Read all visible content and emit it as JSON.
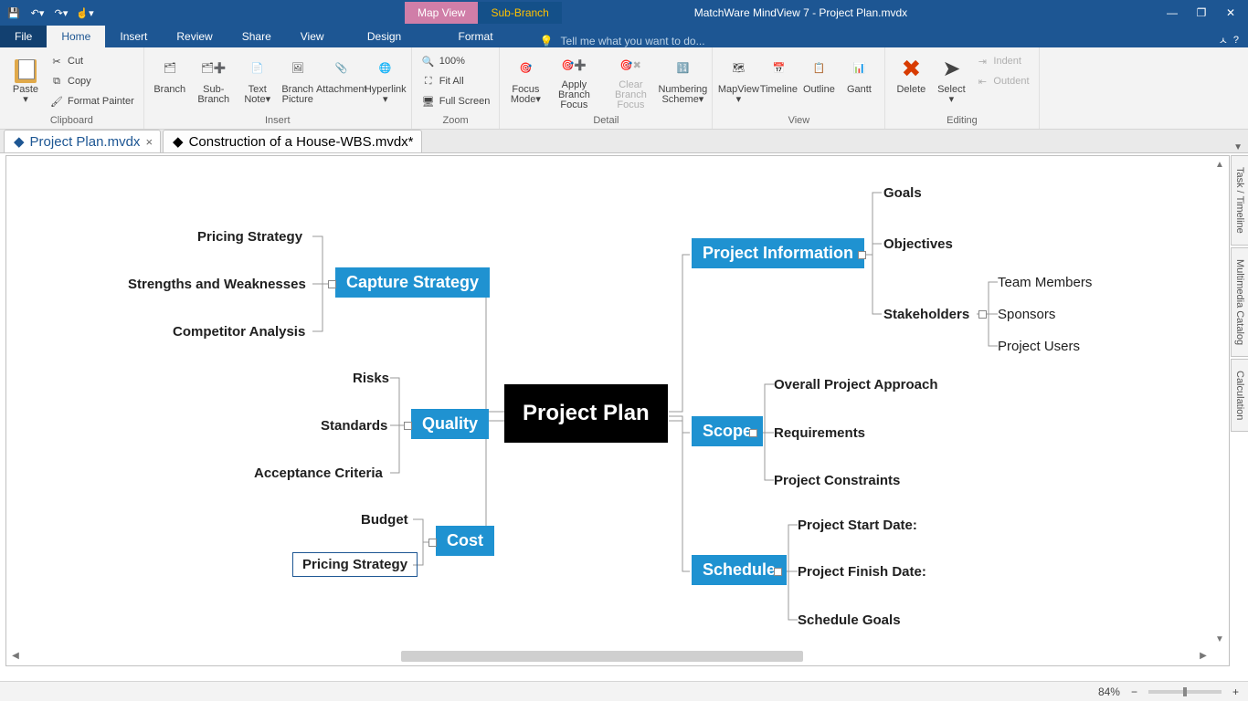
{
  "window": {
    "app_title": "MatchWare MindView 7 - Project Plan.mvdx"
  },
  "context_tabs": {
    "map_view": "Map View",
    "sub_branch": "Sub-Branch"
  },
  "tabs": {
    "file": "File",
    "home": "Home",
    "insert": "Insert",
    "review": "Review",
    "share": "Share",
    "view": "View",
    "design": "Design",
    "format": "Format",
    "tell_me": "Tell me what you want to do..."
  },
  "ribbon": {
    "clipboard": {
      "label": "Clipboard",
      "paste": "Paste",
      "cut": "Cut",
      "copy": "Copy",
      "format_painter": "Format Painter"
    },
    "insert": {
      "label": "Insert",
      "branch": "Branch",
      "sub_branch": "Sub-Branch",
      "text_note": "Text Note▾",
      "branch_picture": "Branch Picture",
      "attachment": "Attachment",
      "hyperlink": "Hyperlink"
    },
    "zoom": {
      "label": "Zoom",
      "z100": "100%",
      "fit_all": "Fit All",
      "full_screen": "Full Screen"
    },
    "detail": {
      "label": "Detail",
      "focus_mode": "Focus Mode▾",
      "apply_branch_focus": "Apply Branch Focus",
      "clear_branch_focus": "Clear Branch Focus",
      "numbering_scheme": "Numbering Scheme▾"
    },
    "view": {
      "label": "View",
      "mapview": "MapView",
      "timeline": "Timeline",
      "outline": "Outline",
      "gantt": "Gantt"
    },
    "editing": {
      "label": "Editing",
      "delete": "Delete",
      "select": "Select",
      "indent": "Indent",
      "outdent": "Outdent"
    }
  },
  "doc_tabs": {
    "t1": "Project Plan.mvdx",
    "t2": "Construction of a House-WBS.mvdx*"
  },
  "mindmap": {
    "central": "Project Plan",
    "left": {
      "capture": {
        "label": "Capture Strategy",
        "children": [
          "Pricing Strategy",
          "Strengths and Weaknesses",
          "Competitor Analysis"
        ]
      },
      "quality": {
        "label": "Quality",
        "children": [
          "Risks",
          "Standards",
          "Acceptance Criteria"
        ]
      },
      "cost": {
        "label": "Cost",
        "children": [
          "Budget",
          "Pricing Strategy"
        ]
      }
    },
    "right": {
      "project_info": {
        "label": "Project Information",
        "children": [
          "Goals",
          "Objectives",
          "Stakeholders"
        ],
        "stakeholders_children": [
          "Team Members",
          "Sponsors",
          "Project Users"
        ]
      },
      "scope": {
        "label": "Scope",
        "children": [
          "Overall Project Approach",
          "Requirements",
          "Project Constraints"
        ]
      },
      "schedule": {
        "label": "Schedule",
        "children": [
          "Project Start Date:",
          "Project Finish Date:",
          "Schedule Goals"
        ]
      }
    }
  },
  "side_panels": [
    "Task / Timeline",
    "Multimedia Catalog",
    "Calculation"
  ],
  "status": {
    "zoom": "84%"
  }
}
